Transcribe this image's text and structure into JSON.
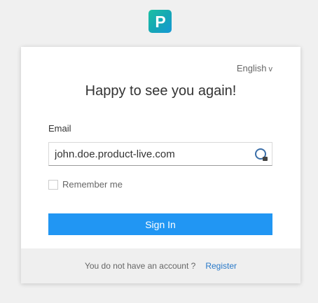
{
  "logo": {
    "letter": "P",
    "icon": "brand-logo-icon"
  },
  "language": {
    "selected": "English",
    "chevron": "v"
  },
  "login": {
    "title": "Happy to see you again!",
    "email_label": "Email",
    "email_value": "john.doe.product-live.com",
    "email_icon": "password-manager-icon",
    "remember_label": "Remember me",
    "remember_checked": false,
    "signin_label": "Sign In"
  },
  "footer": {
    "prompt": "You do not have an account ?",
    "register_label": "Register"
  },
  "colors": {
    "accent": "#2196f3",
    "link": "#2878c8",
    "logo_gradient_start": "#1ac0a2",
    "logo_gradient_end": "#1698d6"
  }
}
